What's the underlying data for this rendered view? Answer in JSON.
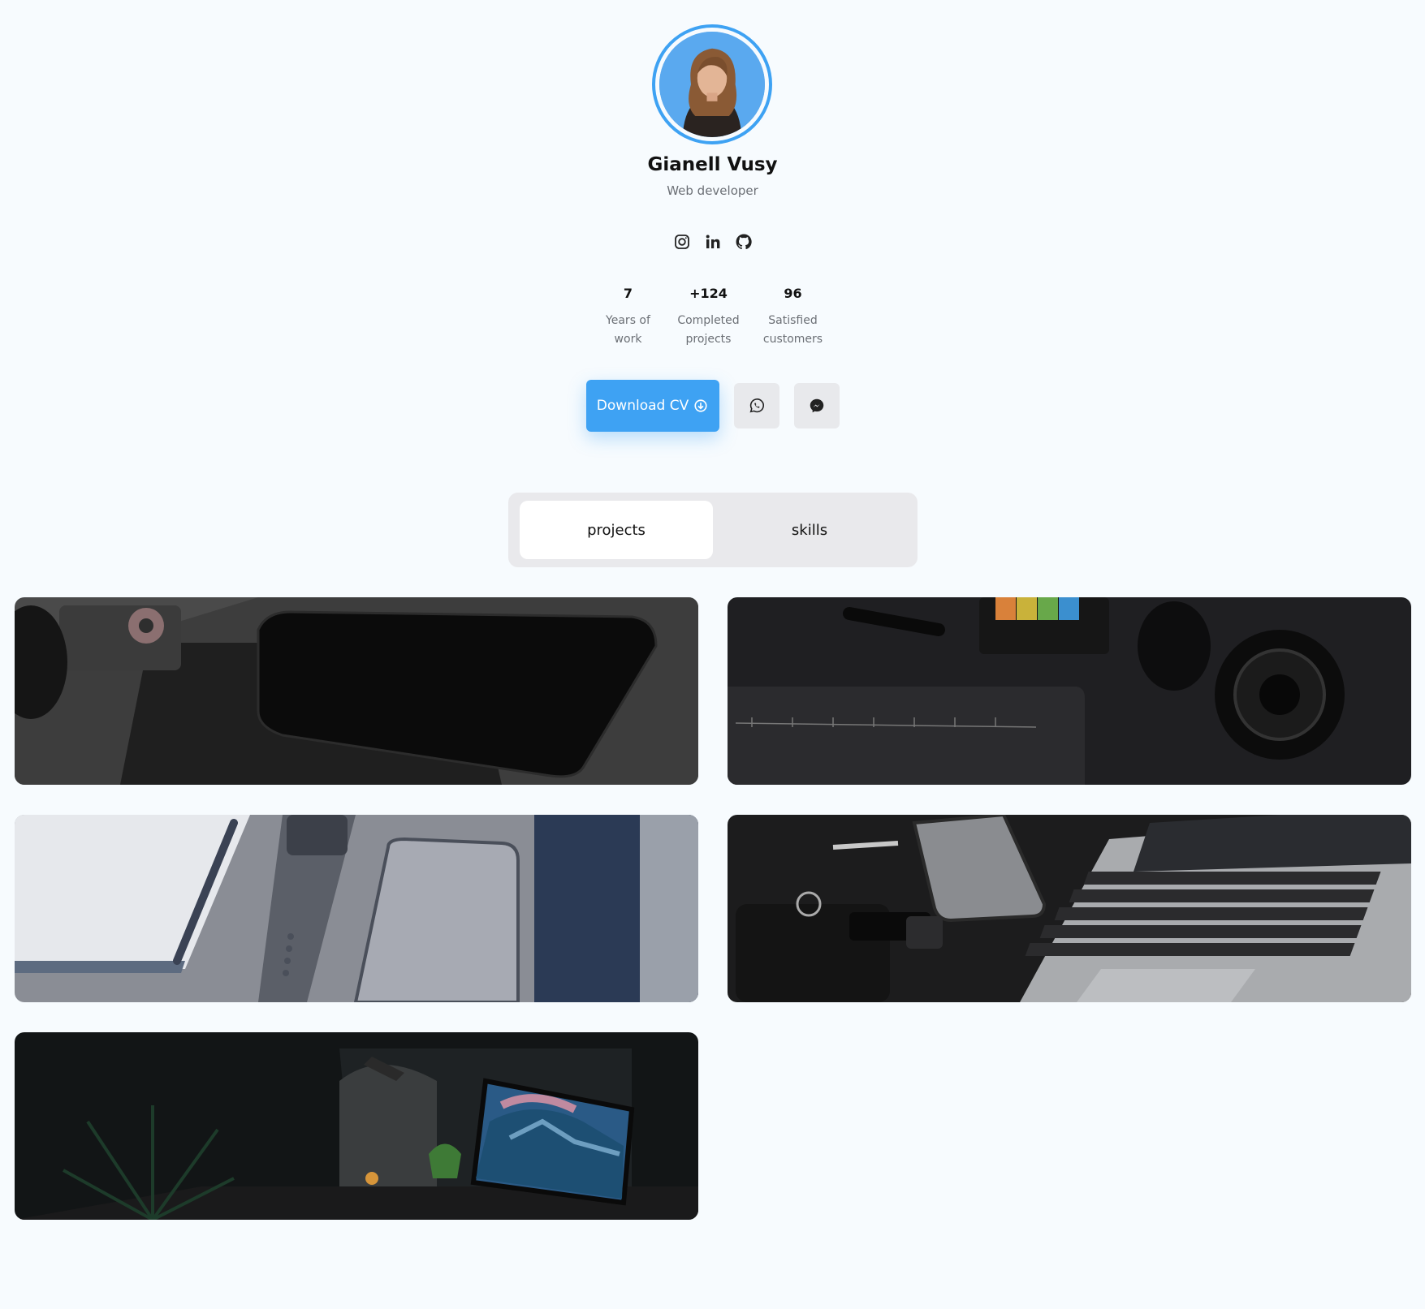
{
  "profile": {
    "name": "Gianell Vusy",
    "role": "Web developer"
  },
  "socials": [
    {
      "icon": "instagram-icon"
    },
    {
      "icon": "linkedin-icon"
    },
    {
      "icon": "github-icon"
    }
  ],
  "stats": [
    {
      "value": "7",
      "label_line1": "Years of",
      "label_line2": "work"
    },
    {
      "value": "+124",
      "label_line1": "Completed",
      "label_line2": "projects"
    },
    {
      "value": "96",
      "label_line1": "Satisfied",
      "label_line2": "customers"
    }
  ],
  "actions": {
    "download_label": "Download CV",
    "download_icon": "arrow-down-circle-icon",
    "whatsapp_icon": "whatsapp-icon",
    "messenger_icon": "messenger-icon"
  },
  "tabs": [
    {
      "label": "projects",
      "active": true
    },
    {
      "label": "skills",
      "active": false
    }
  ],
  "colors": {
    "accent": "#3ea2f3",
    "background": "#f7fbfe",
    "muted_text": "#6b6f75",
    "tab_bg": "#e9e9ec"
  },
  "projects": [
    {
      "image": "tablet-and-ipod-on-desk"
    },
    {
      "image": "camera-lens-and-ruler-on-dark-desk"
    },
    {
      "image": "notebook-watch-and-phone"
    },
    {
      "image": "laptop-phone-and-keys"
    },
    {
      "image": "dark-desk-with-monitor-and-plant"
    }
  ]
}
